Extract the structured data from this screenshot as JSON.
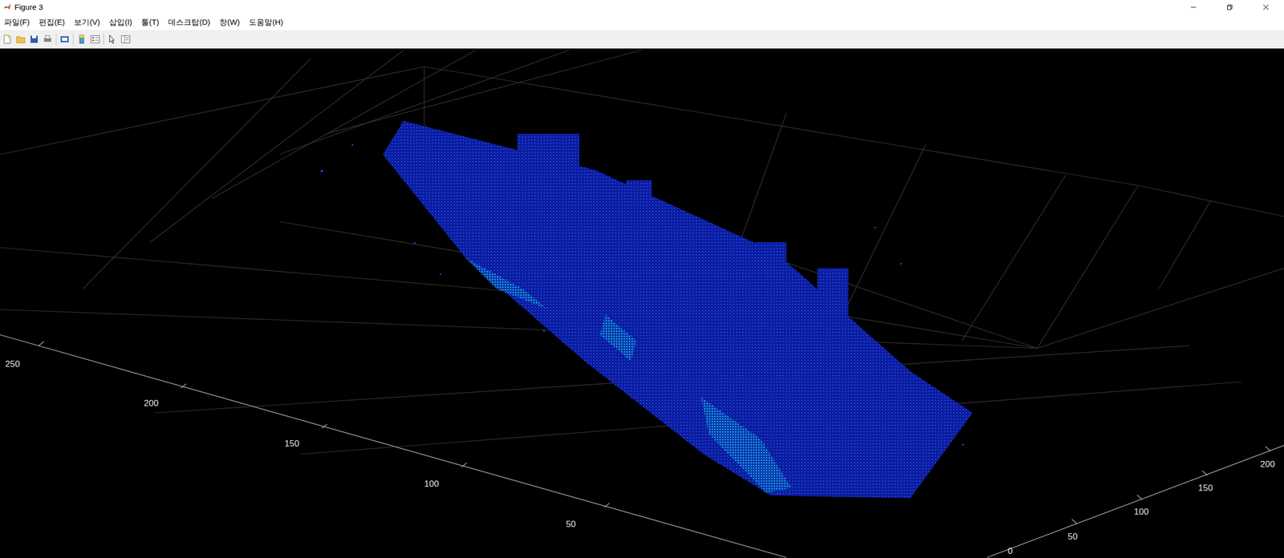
{
  "window": {
    "title": "Figure 3"
  },
  "menu": [
    "파일(F)",
    "편집(E)",
    "보기(V)",
    "삽입(I)",
    "툴(T)",
    "데스크탑(D)",
    "창(W)",
    "도움말(H)"
  ],
  "axes": {
    "x_ticks": [
      "250",
      "200",
      "150",
      "100",
      "50"
    ],
    "y_ticks": [
      "200",
      "150",
      "100",
      "50",
      "0"
    ]
  }
}
